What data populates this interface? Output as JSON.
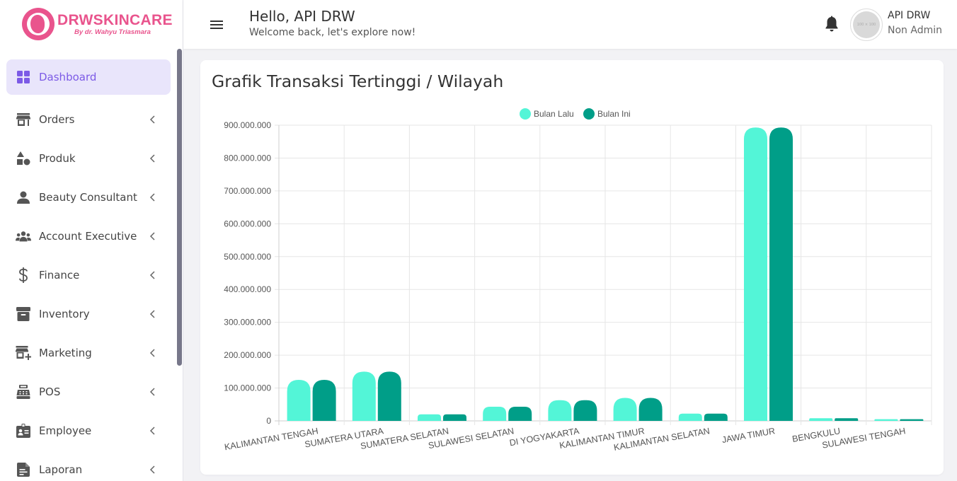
{
  "brand": {
    "name": "DRWSKINCARE",
    "tagline": "By dr. Wahyu Triasmara"
  },
  "nav": {
    "items": [
      {
        "label": "Dashboard",
        "icon": "dashboard-icon",
        "active": true
      },
      {
        "label": "Orders",
        "icon": "store-icon"
      },
      {
        "label": "Produk",
        "icon": "shapes-icon"
      },
      {
        "label": "Beauty Consultant",
        "icon": "person-icon"
      },
      {
        "label": "Account Executive",
        "icon": "group-icon"
      },
      {
        "label": "Finance",
        "icon": "dollar-icon"
      },
      {
        "label": "Inventory",
        "icon": "archive-icon"
      },
      {
        "label": "Marketing",
        "icon": "store-add-icon"
      },
      {
        "label": "POS",
        "icon": "cash-register-icon"
      },
      {
        "label": "Employee",
        "icon": "badge-icon"
      },
      {
        "label": "Laporan",
        "icon": "report-icon"
      }
    ]
  },
  "header": {
    "title": "Hello, API DRW",
    "subtitle": "Welcome back, let's explore now!",
    "user_name": "API DRW",
    "user_role": "Non Admin",
    "avatar_placeholder": "100 × 100"
  },
  "colors": {
    "accent": "#7c5ae6",
    "brand": "#e9548d",
    "series_prev": "#53f5d7",
    "series_curr": "#009e88"
  },
  "chart_data": {
    "type": "bar",
    "title": "Grafik Transaksi Tertinggi / Wilayah",
    "categories": [
      "KALIMANTAN TENGAH",
      "SUMATERA UTARA",
      "SUMATERA SELATAN",
      "SULAWESI SELATAN",
      "DI YOGYAKARTA",
      "KALIMANTAN TIMUR",
      "KALIMANTAN SELATAN",
      "JAWA TIMUR",
      "BENGKULU",
      "SULAWESI TENGAH"
    ],
    "series": [
      {
        "name": "Bulan Lalu",
        "color": "#53f5d7",
        "values": [
          125000000,
          150000000,
          20000000,
          43000000,
          63000000,
          70000000,
          22000000,
          893000000,
          8000000,
          5000000
        ]
      },
      {
        "name": "Bulan Ini",
        "color": "#009e88",
        "values": [
          125000000,
          150000000,
          20000000,
          43000000,
          63000000,
          70000000,
          22000000,
          893000000,
          8000000,
          5000000
        ]
      }
    ],
    "ylim": [
      0,
      900000000
    ],
    "yticks": [
      "0",
      "100.000.000",
      "200.000.000",
      "300.000.000",
      "400.000.000",
      "500.000.000",
      "600.000.000",
      "700.000.000",
      "800.000.000",
      "900.000.000"
    ],
    "legend": "top-center",
    "grid": true
  }
}
